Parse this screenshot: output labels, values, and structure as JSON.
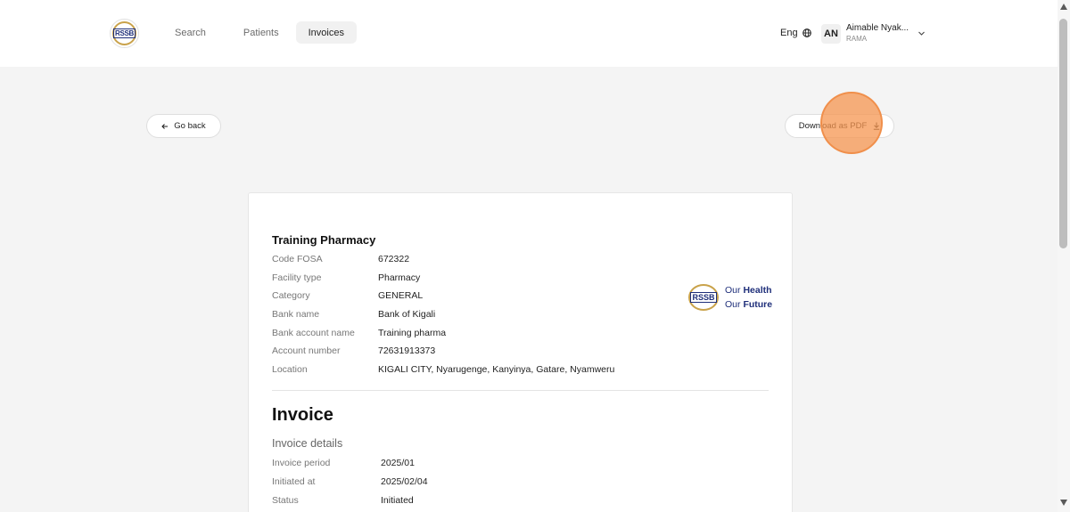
{
  "header": {
    "logo_text": "RSSB",
    "nav": [
      {
        "label": "Search"
      },
      {
        "label": "Patients"
      },
      {
        "label": "Invoices",
        "active": true
      }
    ],
    "language": "Eng",
    "user": {
      "initials": "AN",
      "name": "Aimable Nyak...",
      "role": "RAMA"
    }
  },
  "actions": {
    "back_label": "Go back",
    "download_label": "Download as PDF"
  },
  "facility": {
    "name": "Training Pharmacy",
    "fields": [
      {
        "label": "Code FOSA",
        "value": "672322"
      },
      {
        "label": "Facility type",
        "value": "Pharmacy"
      },
      {
        "label": "Category",
        "value": "GENERAL"
      },
      {
        "label": "Bank name",
        "value": "Bank of Kigali"
      },
      {
        "label": "Bank account name",
        "value": "Training pharma"
      },
      {
        "label": "Account number",
        "value": "72631913373"
      },
      {
        "label": "Location",
        "value": "KIGALI CITY, Nyarugenge, Kanyinya, Gatare, Nyamweru"
      }
    ]
  },
  "brand": {
    "logo_text": "RSSB",
    "line1_prefix": "Our",
    "line1_bold": "Health",
    "line2_prefix": "Our",
    "line2_bold": "Future"
  },
  "invoice": {
    "title": "Invoice",
    "subtitle": "Invoice details",
    "fields": [
      {
        "label": "Invoice period",
        "value": "2025/01"
      },
      {
        "label": "Initiated at",
        "value": "2025/02/04"
      },
      {
        "label": "Status",
        "value": "Initiated"
      }
    ]
  },
  "colors": {
    "brand_blue": "#1f2f7a",
    "brand_gold": "#c9a24a",
    "click_marker": "#f59650"
  }
}
